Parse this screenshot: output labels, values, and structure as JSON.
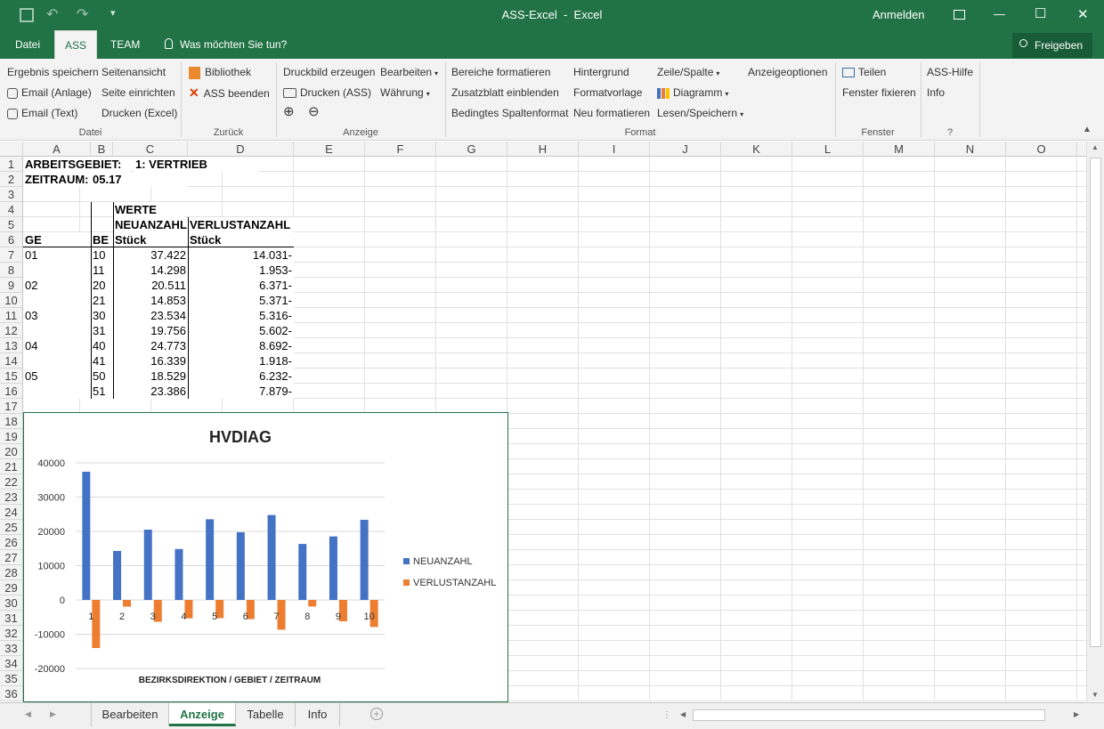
{
  "titlebar": {
    "title": "ASS-Excel  -  Excel",
    "signin": "Anmelden",
    "minimize": "—",
    "maximize": "☐",
    "close": "✕"
  },
  "tabs": {
    "datei": "Datei",
    "ass": "ASS",
    "team": "TEAM",
    "search": "Was möchten Sie tun?",
    "share": "Freigeben"
  },
  "ribbon": {
    "datei": {
      "label": "Datei",
      "ergebnis": "Ergebnis speichern",
      "email_anlage": "Email (Anlage)",
      "email_text": "Email (Text)",
      "seitenansicht": "Seitenansicht",
      "seite_einrichten": "Seite einrichten",
      "drucken_excel": "Drucken (Excel)"
    },
    "zurueck": {
      "label": "Zurück",
      "bibliothek": "Bibliothek",
      "ass_beenden": "ASS beenden"
    },
    "anzeige": {
      "label": "Anzeige",
      "druckbild": "Druckbild erzeugen",
      "drucken_ass": "Drucken (ASS)",
      "bearbeiten": "Bearbeiten",
      "waehrung": "Währung"
    },
    "format": {
      "label": "Format",
      "bereiche": "Bereiche formatieren",
      "zusatzblatt": "Zusatzblatt einblenden",
      "bedingtes": "Bedingtes Spaltenformat",
      "hintergrund": "Hintergrund",
      "formatvorlage": "Formatvorlage",
      "neu_formatieren": "Neu formatieren",
      "zeile_spalte": "Zeile/Spalte",
      "diagramm": "Diagramm",
      "lesen_speichern": "Lesen/Speichern",
      "anzeigeoptionen": "Anzeigeoptionen"
    },
    "fenster": {
      "label": "Fenster",
      "teilen": "Teilen",
      "fixieren": "Fenster fixieren"
    },
    "hilfe": {
      "label": "?",
      "ass_hilfe": "ASS-Hilfe",
      "info": "Info"
    }
  },
  "columns": [
    "A",
    "B",
    "C",
    "D",
    "E",
    "F",
    "G",
    "H",
    "I",
    "J",
    "K",
    "L",
    "M",
    "N",
    "O"
  ],
  "rows": [
    "1",
    "2",
    "3",
    "4",
    "5",
    "6",
    "7",
    "8",
    "9",
    "10",
    "11",
    "12",
    "13",
    "14",
    "15",
    "16",
    "17",
    "18",
    "19",
    "20",
    "21",
    "22",
    "23",
    "24",
    "25",
    "26",
    "27",
    "28",
    "29",
    "30",
    "31",
    "32",
    "33",
    "34",
    "35",
    "36"
  ],
  "sheet": {
    "r1_label": "ARBEITSGEBIET:",
    "r1_value": "1: VERTRIEB",
    "r2_label": "ZEITRAUM:",
    "r2_value": "05.17",
    "werte": "WERTE",
    "neuanzahl": "NEUANZAHL",
    "verlustanzahl": "VERLUSTANZAHL",
    "ge": "GE",
    "be": "BE",
    "stueck1": "Stück",
    "stueck2": "Stück",
    "data": [
      {
        "ge": "01",
        "be": "10",
        "neu": "37.422",
        "verl": "14.031-"
      },
      {
        "ge": "",
        "be": "11",
        "neu": "14.298",
        "verl": "1.953-"
      },
      {
        "ge": "02",
        "be": "20",
        "neu": "20.511",
        "verl": "6.371-"
      },
      {
        "ge": "",
        "be": "21",
        "neu": "14.853",
        "verl": "5.371-"
      },
      {
        "ge": "03",
        "be": "30",
        "neu": "23.534",
        "verl": "5.316-"
      },
      {
        "ge": "",
        "be": "31",
        "neu": "19.756",
        "verl": "5.602-"
      },
      {
        "ge": "04",
        "be": "40",
        "neu": "24.773",
        "verl": "8.692-"
      },
      {
        "ge": "",
        "be": "41",
        "neu": "16.339",
        "verl": "1.918-"
      },
      {
        "ge": "05",
        "be": "50",
        "neu": "18.529",
        "verl": "6.232-"
      },
      {
        "ge": "",
        "be": "51",
        "neu": "23.386",
        "verl": "7.879-"
      }
    ]
  },
  "chart_data": {
    "type": "bar",
    "title": "HVDIAG",
    "xlabel": "BEZIRKSDIREKTION / GEBIET / ZEITRAUM",
    "ylabel": "",
    "categories": [
      "1",
      "2",
      "3",
      "4",
      "5",
      "6",
      "7",
      "8",
      "9",
      "10"
    ],
    "ylim": [
      -20000,
      40000
    ],
    "yticks": [
      "40000",
      "30000",
      "20000",
      "10000",
      "0",
      "-10000",
      "-20000"
    ],
    "legend_position": "right",
    "grid": true,
    "series": [
      {
        "name": "NEUANZAHL",
        "color": "#4472c4",
        "values": [
          37422,
          14298,
          20511,
          14853,
          23534,
          19756,
          24773,
          16339,
          18529,
          23386
        ]
      },
      {
        "name": "VERLUSTANZAHL",
        "color": "#ed7d31",
        "values": [
          -14031,
          -1953,
          -6371,
          -5371,
          -5316,
          -5602,
          -8692,
          -1918,
          -6232,
          -7879
        ]
      }
    ]
  },
  "sheettabs": {
    "bearbeiten": "Bearbeiten",
    "anzeige": "Anzeige",
    "tabelle": "Tabelle",
    "info": "Info"
  },
  "colors": {
    "accent": "#217346"
  }
}
